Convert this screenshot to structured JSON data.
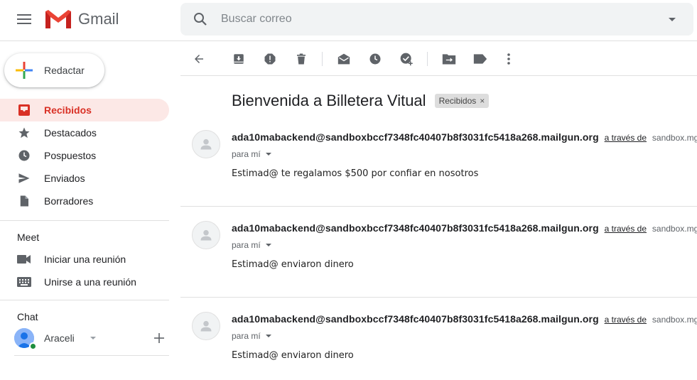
{
  "app": {
    "name": "Gmail"
  },
  "search": {
    "placeholder": "Buscar correo"
  },
  "compose": {
    "label": "Redactar"
  },
  "nav": [
    {
      "label": "Recibidos",
      "icon": "inbox-icon",
      "active": true
    },
    {
      "label": "Destacados",
      "icon": "star-icon"
    },
    {
      "label": "Pospuestos",
      "icon": "clock-icon"
    },
    {
      "label": "Enviados",
      "icon": "send-icon"
    },
    {
      "label": "Borradores",
      "icon": "draft-icon"
    }
  ],
  "meet": {
    "title": "Meet",
    "items": [
      {
        "label": "Iniciar una reunión",
        "icon": "video-icon"
      },
      {
        "label": "Unirse a una reunión",
        "icon": "keyboard-icon"
      }
    ]
  },
  "chat": {
    "title": "Chat",
    "user": "Araceli",
    "status_color": "#1e8e3e"
  },
  "thread": {
    "subject": "Bienvenida a Billetera Vitual",
    "label": "Recibidos",
    "messages": [
      {
        "sender": "ada10mabackend@sandboxbccf7348fc40407b8f3031fc5418a268.mailgun.org",
        "via": "a través de",
        "via_domain": "sandbox.mg...",
        "to": "para mí",
        "body": "Estimad@ te regalamos $500 por confiar en nosotros"
      },
      {
        "sender": "ada10mabackend@sandboxbccf7348fc40407b8f3031fc5418a268.mailgun.org",
        "via": "a través de",
        "via_domain": "sandbox.mg...",
        "to": "para mí",
        "body": "Estimad@ enviaron dinero"
      },
      {
        "sender": "ada10mabackend@sandboxbccf7348fc40407b8f3031fc5418a268.mailgun.org",
        "via": "a través de",
        "via_domain": "sandbox.mg...",
        "to": "para mí",
        "body": "Estimad@ enviaron dinero"
      }
    ]
  },
  "colors": {
    "accent": "#d93025",
    "active_bg": "#fce8e6",
    "search_bg": "#f1f3f4"
  }
}
